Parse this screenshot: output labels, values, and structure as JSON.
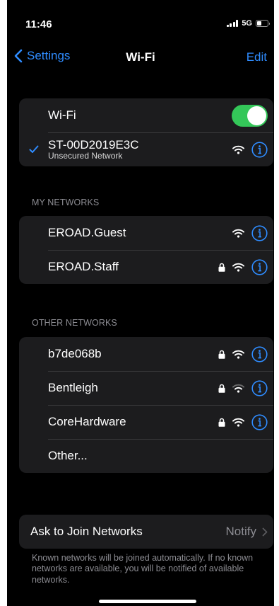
{
  "status_bar": {
    "time": "11:46",
    "network": "5G"
  },
  "nav": {
    "back_label": "Settings",
    "title": "Wi-Fi",
    "edit_label": "Edit"
  },
  "wifi_toggle": {
    "label": "Wi-Fi",
    "state": "on"
  },
  "connected_network": {
    "name": "ST-00D2019E3C",
    "subtitle": "Unsecured Network"
  },
  "my_networks": {
    "header": "MY NETWORKS",
    "items": [
      {
        "name": "EROAD.Guest",
        "locked": false
      },
      {
        "name": "EROAD.Staff",
        "locked": true
      }
    ]
  },
  "other_networks": {
    "header": "OTHER NETWORKS",
    "items": [
      {
        "name": "b7de068b",
        "locked": true
      },
      {
        "name": "Bentleigh",
        "locked": true
      },
      {
        "name": "CoreHardware",
        "locked": true
      }
    ],
    "other_label": "Other..."
  },
  "ask_to_join": {
    "label": "Ask to Join Networks",
    "value": "Notify",
    "footnote": "Known networks will be joined automatically. If no known networks are available, you will be notified of available networks."
  },
  "colors": {
    "accent": "#2f8cff",
    "toggle_on": "#34c759",
    "group_bg": "#1c1c1e",
    "secondary_text": "#8d8d93"
  },
  "icons": [
    "chevron-left-icon",
    "checkmark-icon",
    "wifi-icon",
    "lock-icon",
    "info-icon",
    "chevron-right-icon"
  ]
}
